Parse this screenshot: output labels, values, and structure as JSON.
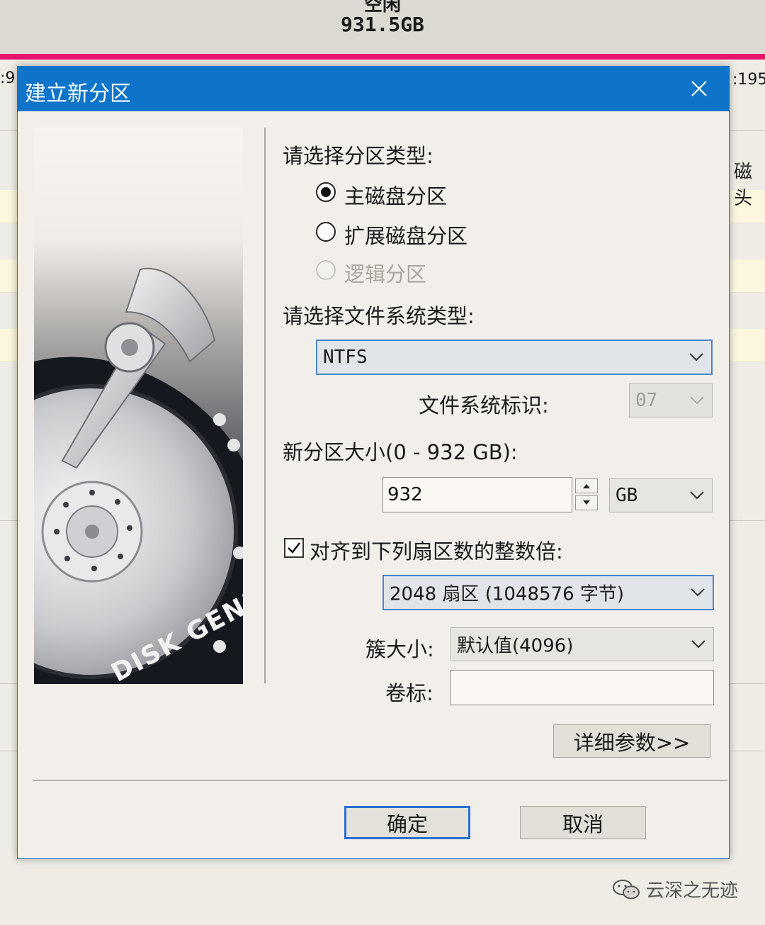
{
  "background": {
    "free_label": "空闲",
    "free_size": "931.5GB",
    "left_fragment": ":9",
    "right_fragment": ":195",
    "right_fragment2": "磁头",
    "watermark": "云深之无迹"
  },
  "dialog": {
    "title": "建立新分区",
    "partition_type_label": "请选择分区类型:",
    "partition_types": [
      {
        "label": "主磁盘分区",
        "checked": true,
        "enabled": true
      },
      {
        "label": "扩展磁盘分区",
        "checked": false,
        "enabled": true
      },
      {
        "label": "逻辑分区",
        "checked": false,
        "enabled": false
      }
    ],
    "fs_type_label": "请选择文件系统类型:",
    "fs_type_value": "NTFS",
    "fs_id_label": "文件系统标识:",
    "fs_id_value": "07",
    "size_label": "新分区大小(0 - 932 GB):",
    "size_value": "932",
    "size_unit": "GB",
    "align_label": "对齐到下列扇区数的整数倍:",
    "align_checked": true,
    "align_value": "2048 扇区 (1048576 字节)",
    "cluster_label": "簇大小:",
    "cluster_value": "默认值(4096)",
    "volume_label": "卷标:",
    "volume_value": "",
    "details_button": "详细参数>>",
    "ok_button": "确定",
    "cancel_button": "取消",
    "disk_brand": "DISK GENIUS"
  },
  "colors": {
    "titlebar": "#0d74c9",
    "accent_border": "#4a86c8",
    "pink_bar": "#e8146c"
  }
}
